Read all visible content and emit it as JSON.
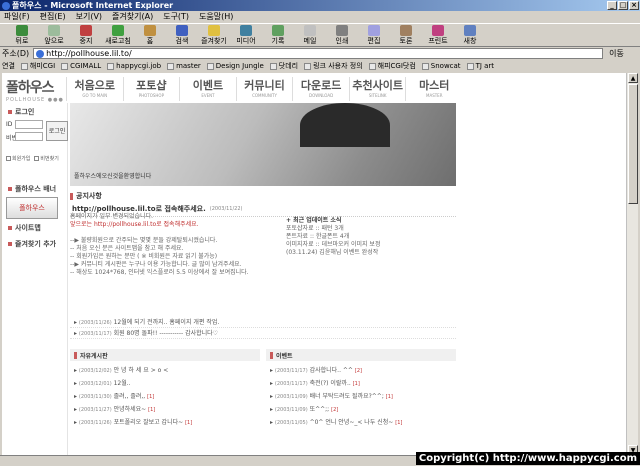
{
  "window": {
    "title": "폴하우스 - Microsoft Internet Explorer",
    "buttons": [
      "_",
      "□",
      "×"
    ]
  },
  "menu": [
    "파일(F)",
    "편집(E)",
    "보기(V)",
    "즐겨찾기(A)",
    "도구(T)",
    "도움말(H)"
  ],
  "toolbar": [
    "뒤로",
    "앞으로",
    "중지",
    "새로고침",
    "홈",
    "검색",
    "즐겨찾기",
    "미디어",
    "기록",
    "메일",
    "인쇄",
    "편집",
    "토론",
    "프린트",
    "새창"
  ],
  "address": {
    "label": "주소(D)",
    "value": "http://pollhouse.lil.to/",
    "go": "이동"
  },
  "links": {
    "label": "연결",
    "items": [
      "해미CGI",
      "CGIMALL",
      "happycgi.job",
      "master",
      "Design Jungle",
      "닷데리",
      "링크 사용자 정의",
      "해피CGI닷컴",
      "Snowcat",
      "TJ art"
    ]
  },
  "logo": {
    "title": "폴하우스",
    "sub": "POLLHOUSE ●●●"
  },
  "nav": [
    {
      "k": "처음으로",
      "e": "GO TO MAIN"
    },
    {
      "k": "포토샵",
      "e": "PHOTOSHOP"
    },
    {
      "k": "이벤트",
      "e": "EVENT"
    },
    {
      "k": "커뮤니티",
      "e": "COMMUNITY"
    },
    {
      "k": "다운로드",
      "e": "DOWNLOAD"
    },
    {
      "k": "추천사이트",
      "e": "SITELINK"
    },
    {
      "k": "마스터",
      "e": "MASTER"
    }
  ],
  "sidebar": {
    "login_title": "로그인",
    "id_label": "ID",
    "pw_label": "비번",
    "login_btn": "로그인",
    "join": "회원가입",
    "find": "비번찾기",
    "banner_title": "폴하우스 배너",
    "banner_text": "폴하우스",
    "sitemap": "사이트맵",
    "favorite": "즐겨찾기 추가"
  },
  "hero": {
    "caption": "폴하우스에오신것을환영합니다"
  },
  "notice": {
    "title": "공지사항",
    "headline": "http://pollhouse.lil.to로 접속해주세요.",
    "date": "(2003/11/22)",
    "body": [
      "홈페이지가 일부 변경되었습니다.",
      "앞으로는 http://pollhouse.lil.to로 접속해주세요.",
      "",
      "--▶ 불량회원으로 간주되는 몇몇 분들 강제탈퇴시켰습니다.",
      "-- 처음 오신 분은 사이트맵을 참고 해 주세요.",
      "-- 회원가입은 원하는 분만 ( ※ 비회원은 자료 읽기 불가능)",
      "--▶ 커뮤니티 게시판은 누구나 이용 가능합니다. 글 많이 남겨주세요.",
      "-- 해상도 1024*768, 인터넷 익스플로러 5.5 이상에서 잘 보여집니다."
    ],
    "updates_title": "+ 최근 업데이트 소식",
    "updates": [
      "포토샵자료 :: 패턴 3개",
      "폰트자료 :: 한글폰트 4개",
      "이미지자료 :: 데브마오커 이미지 보정",
      "(03.11.24) 김윤해님 이벤트 완성작"
    ]
  },
  "notice_list": [
    {
      "date": "(2003/11/26)",
      "text": "12월에 되기 전까지.. 홈페이지 개편 작업."
    },
    {
      "date": "(2003/11/17)",
      "text": "회원 80명 돌파!! ----------- 감사합니다♡"
    }
  ],
  "boards": [
    {
      "title": "자유게시판",
      "rows": [
        {
          "date": "(2003/12/02)",
          "text": "안 녕 하 세 요 > o <",
          "count": ""
        },
        {
          "date": "(2003/12/01)",
          "text": "12월..",
          "count": ""
        },
        {
          "date": "(2003/11/30)",
          "text": "졸려,, 졸려,,",
          "count": "[1]"
        },
        {
          "date": "(2003/11/27)",
          "text": "안녕하세요~",
          "count": "[1]"
        },
        {
          "date": "(2003/11/26)",
          "text": "포트폴리오 잘보고 갑니다~",
          "count": "[1]"
        }
      ]
    },
    {
      "title": "이벤트",
      "rows": [
        {
          "date": "(2003/11/17)",
          "text": "감사합니다.. ^^",
          "count": "[2]"
        },
        {
          "date": "(2003/11/17)",
          "text": "축전(?) 이랄까..",
          "count": "[1]"
        },
        {
          "date": "(2003/11/09)",
          "text": "배너 부탁드려도 될까요?^^;",
          "count": "[1]"
        },
        {
          "date": "(2003/11/09)",
          "text": "또^^;;",
          "count": "[2]"
        },
        {
          "date": "(2003/11/05)",
          "text": "^0^ 언니 안녕~_< 나두 신청~",
          "count": "[1]"
        }
      ]
    }
  ],
  "watermark": "Copyright(c) http://www.happycgi.com"
}
